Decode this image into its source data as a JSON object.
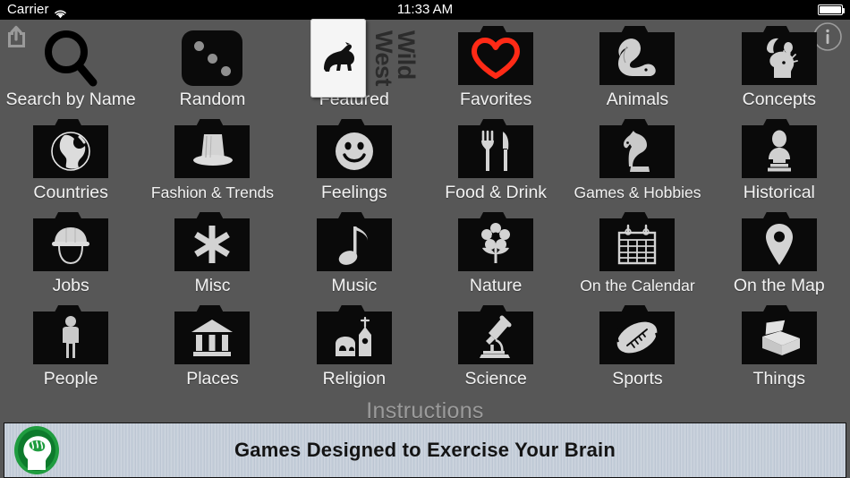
{
  "status_bar": {
    "carrier": "Carrier",
    "wifi_icon": "wifi-icon",
    "time": "11:33 AM",
    "battery_icon": "battery-icon"
  },
  "top_bar": {
    "share_icon": "share-icon",
    "info_icon": "info-icon"
  },
  "colors": {
    "background": "#575757",
    "label": "#f2f2f2",
    "folder": "#0a0a0a",
    "glyph": "#cfcfcf",
    "heart": "#ff2a16",
    "banner_logo_green": "#1f9c3f",
    "instructions_text": "#9b9b9b"
  },
  "grid": {
    "rows": [
      [
        {
          "label": "Search by Name",
          "icon": "magnifier-icon",
          "style": "plain"
        },
        {
          "label": "Random",
          "icon": "die-icon",
          "style": "die"
        },
        {
          "label": "Featured",
          "icon": "horse-icon",
          "style": "card",
          "card_title_line1": "Wild",
          "card_title_line2": "West"
        },
        {
          "label": "Favorites",
          "icon": "heart-icon",
          "style": "folder"
        },
        {
          "label": "Animals",
          "icon": "squirrel-icon",
          "style": "folder"
        },
        {
          "label": "Concepts",
          "icon": "head-lightbulb-icon",
          "style": "folder"
        }
      ],
      [
        {
          "label": "Countries",
          "icon": "globe-icon",
          "style": "folder"
        },
        {
          "label": "Fashion & Trends",
          "icon": "top-hat-icon",
          "style": "folder"
        },
        {
          "label": "Feelings",
          "icon": "smiley-face-icon",
          "style": "folder"
        },
        {
          "label": "Food & Drink",
          "icon": "fork-knife-icon",
          "style": "folder"
        },
        {
          "label": "Games & Hobbies",
          "icon": "chess-knight-icon",
          "style": "folder"
        },
        {
          "label": "Historical",
          "icon": "bust-statue-icon",
          "style": "folder"
        }
      ],
      [
        {
          "label": "Jobs",
          "icon": "hard-hat-icon",
          "style": "folder"
        },
        {
          "label": "Misc",
          "icon": "asterisk-icon",
          "style": "folder"
        },
        {
          "label": "Music",
          "icon": "music-note-icon",
          "style": "folder"
        },
        {
          "label": "Nature",
          "icon": "flower-icon",
          "style": "folder"
        },
        {
          "label": "On the Calendar",
          "icon": "calendar-icon",
          "style": "folder"
        },
        {
          "label": "On the Map",
          "icon": "map-pin-icon",
          "style": "folder"
        }
      ],
      [
        {
          "label": "People",
          "icon": "person-icon",
          "style": "folder"
        },
        {
          "label": "Places",
          "icon": "museum-icon",
          "style": "folder"
        },
        {
          "label": "Religion",
          "icon": "church-icon",
          "style": "folder"
        },
        {
          "label": "Science",
          "icon": "microscope-icon",
          "style": "folder"
        },
        {
          "label": "Sports",
          "icon": "football-icon",
          "style": "folder"
        },
        {
          "label": "Things",
          "icon": "open-box-icon",
          "style": "folder"
        }
      ]
    ]
  },
  "instructions": {
    "label": "Instructions"
  },
  "banner": {
    "text": "Games Designed to Exercise Your Brain",
    "logo_icon": "brain-head-icon"
  }
}
